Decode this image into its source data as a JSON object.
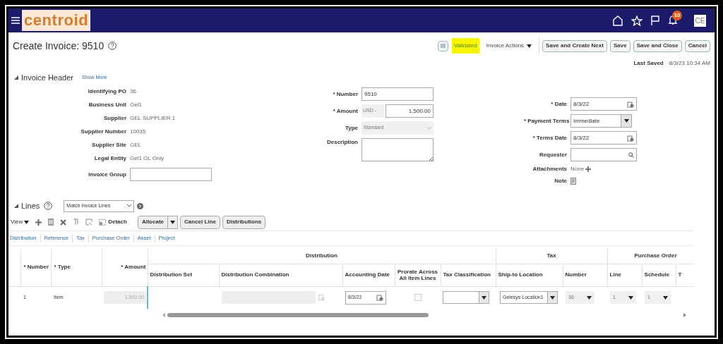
{
  "app_bar": {
    "logo": "centroid",
    "notification_count": "10",
    "user_initials": "CE"
  },
  "page": {
    "title": "Create Invoice: 9510",
    "status": "Validated",
    "actions_menu": "Invoice Actions",
    "buttons": [
      "Save and Create Next",
      "Save",
      "Save and Close",
      "Cancel"
    ],
    "last_saved_label": "Last Saved",
    "last_saved_value": "8/3/23 10:34 AM"
  },
  "invoice_header": {
    "title": "Invoice Header",
    "show_more": "Show More",
    "fields_left": [
      {
        "label": "Identifying PO",
        "value": "36",
        "kind": "text"
      },
      {
        "label": "Business Unit",
        "value": "Gel1",
        "kind": "text"
      },
      {
        "label": "Supplier",
        "value": "GEL SUPPLIER 1",
        "kind": "text"
      },
      {
        "label": "Supplier Number",
        "value": "10035",
        "kind": "text"
      },
      {
        "label": "Supplier Site",
        "value": "GEL",
        "kind": "text"
      },
      {
        "label": "Legal Entity",
        "value": "Gel1 GL Only",
        "kind": "text"
      },
      {
        "label": "Invoice Group",
        "kind": "input"
      }
    ],
    "fields_middle": [
      {
        "label": "* Number",
        "value": "9510",
        "kind": "input"
      },
      {
        "label": "* Amount",
        "currency": "USD -",
        "value": "1,500.00",
        "kind": "amount"
      },
      {
        "label": "Type",
        "value": "Standard",
        "kind": "select",
        "disabled": true
      },
      {
        "label": "Description",
        "kind": "textarea"
      }
    ],
    "fields_right": [
      {
        "label": "* Date",
        "value": "8/3/22",
        "kind": "date"
      },
      {
        "label": "* Payment Terms",
        "value": "Immediate",
        "kind": "choice"
      },
      {
        "label": "* Terms Date",
        "value": "8/3/22",
        "kind": "date"
      },
      {
        "label": "Requester",
        "kind": "search"
      },
      {
        "label": "Attachments",
        "value": "None",
        "kind": "attachments"
      },
      {
        "label": "Note",
        "kind": "note"
      }
    ]
  },
  "lines": {
    "title": "Lines",
    "match_select": "Match Invoice Lines",
    "view_menu": "View",
    "detach": "Detach",
    "buttons": [
      "Allocate",
      "Cancel Line",
      "Distributions"
    ],
    "tabs": [
      "Distribution",
      "Reference",
      "Tax",
      "Purchase Order",
      "Asset",
      "Project"
    ],
    "table": {
      "groups": [
        "Distribution",
        "Tax",
        "Purchase Order"
      ],
      "fixed_columns": [
        "* Number",
        "* Type",
        "* Amount"
      ],
      "columns": [
        "Distribution Set",
        "Distribution Combination",
        "Accounting Date",
        "Prorate Across All Item Lines",
        "Tax Classification",
        "Ship-to Location",
        "Number",
        "Line",
        "Schedule",
        "T"
      ],
      "rows": [
        {
          "number": "1",
          "type": "Item",
          "amount": "1,500.00",
          "accounting_date": "8/3/22",
          "prorate_checked": false,
          "ship_to": "Gelesys Location1",
          "po_number": "36",
          "po_line": "1",
          "po_schedule": "1"
        }
      ]
    }
  }
}
